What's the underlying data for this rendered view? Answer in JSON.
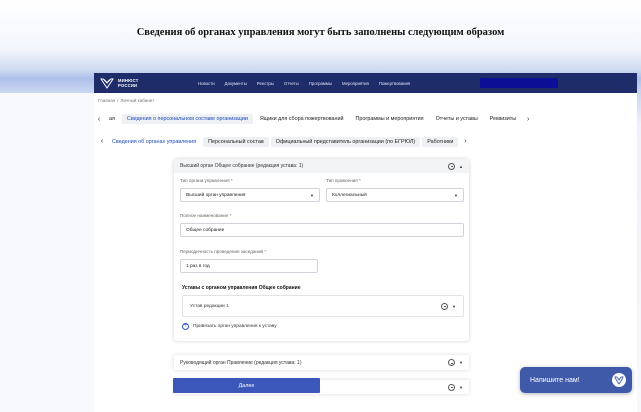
{
  "banner": "Сведения об органах управления могут быть заполнены следующим образом",
  "header": {
    "logo_line1": "МИНЮСТ",
    "logo_line2": "РОССИИ",
    "nav": [
      "Новости",
      "Документы",
      "Реестры",
      "Отчеты",
      "Программы",
      "Мероприятия",
      "Пожертвования"
    ]
  },
  "breadcrumb": {
    "home": "Главная",
    "current": "Личный кабинет"
  },
  "tabs_primary": {
    "partial_first": "ая",
    "items": [
      "Сведения о персональном составе организации",
      "Ящики для сбора пожертвований",
      "Программы и мероприятия",
      "Отчеты и уставы",
      "Реквизиты"
    ]
  },
  "tabs_secondary": {
    "items": [
      "Сведения об органах управления",
      "Персональный состав",
      "Официальный представитель организации (по ЕГРЮЛ)",
      "Работники"
    ]
  },
  "card": {
    "title": "Высший орган Общее собрание (редакция устава: 1)",
    "type_label": "Тип органа управления *",
    "type_value": "Высший орган управления",
    "mgmt_type_label": "Тип правления *",
    "mgmt_type_value": "Коллегиальный",
    "full_name_label": "Полное наименование *",
    "full_name_value": "Общее собрание",
    "period_label": "Периодичность проведения заседаний *",
    "period_value": "1 раз в год",
    "charters_title": "Уставы с органом управления Общее собрание",
    "charter_item": "Устав редакции 1",
    "attach_label": "Привязать орган управления к уставу"
  },
  "card2": {
    "title": "Руководящий орган Правление (редакция устава: 1)"
  },
  "next_button": "Далее",
  "chat": {
    "label": "Напишите нам!"
  },
  "colors": {
    "header": "#1f2c6a",
    "accent": "#3b57b9",
    "chat": "#3f5aa8"
  }
}
